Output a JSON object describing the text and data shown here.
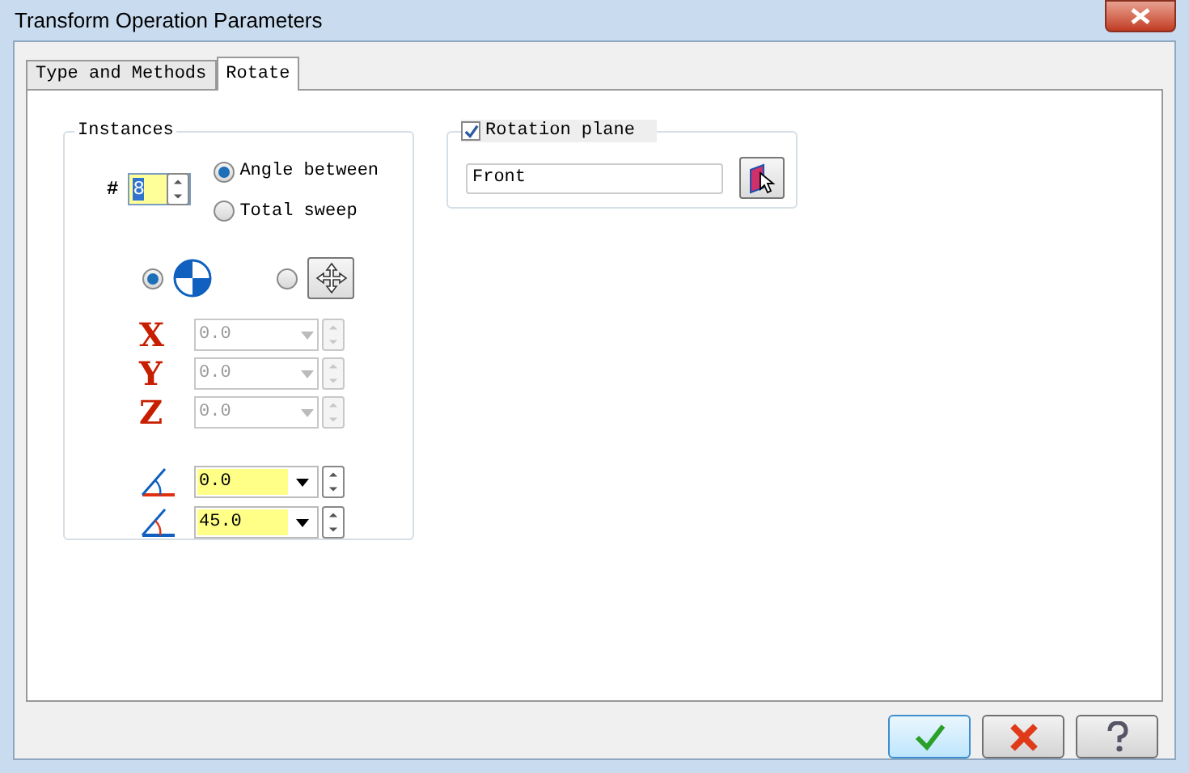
{
  "window": {
    "title": "Transform Operation Parameters"
  },
  "tabs": [
    {
      "label": "Type and Methods",
      "selected": false
    },
    {
      "label": "Rotate",
      "selected": true
    }
  ],
  "instances": {
    "title": "Instances",
    "count_label": "#",
    "count": "8",
    "modes": [
      {
        "label": "Angle between",
        "selected": true
      },
      {
        "label": "Total sweep",
        "selected": false
      }
    ],
    "origin_options": [
      {
        "kind": "quadrant",
        "selected": true
      },
      {
        "kind": "move",
        "selected": false
      }
    ],
    "axes": [
      {
        "label": "X",
        "value": "0.0",
        "disabled": true
      },
      {
        "label": "Y",
        "value": "0.0",
        "disabled": true
      },
      {
        "label": "Z",
        "value": "0.0",
        "disabled": true
      }
    ],
    "angles": [
      {
        "kind": "start",
        "value": "0.0"
      },
      {
        "kind": "sweep",
        "value": "45.0"
      }
    ]
  },
  "rotation_plane": {
    "label": "Rotation plane",
    "checked": true,
    "value": "Front"
  }
}
